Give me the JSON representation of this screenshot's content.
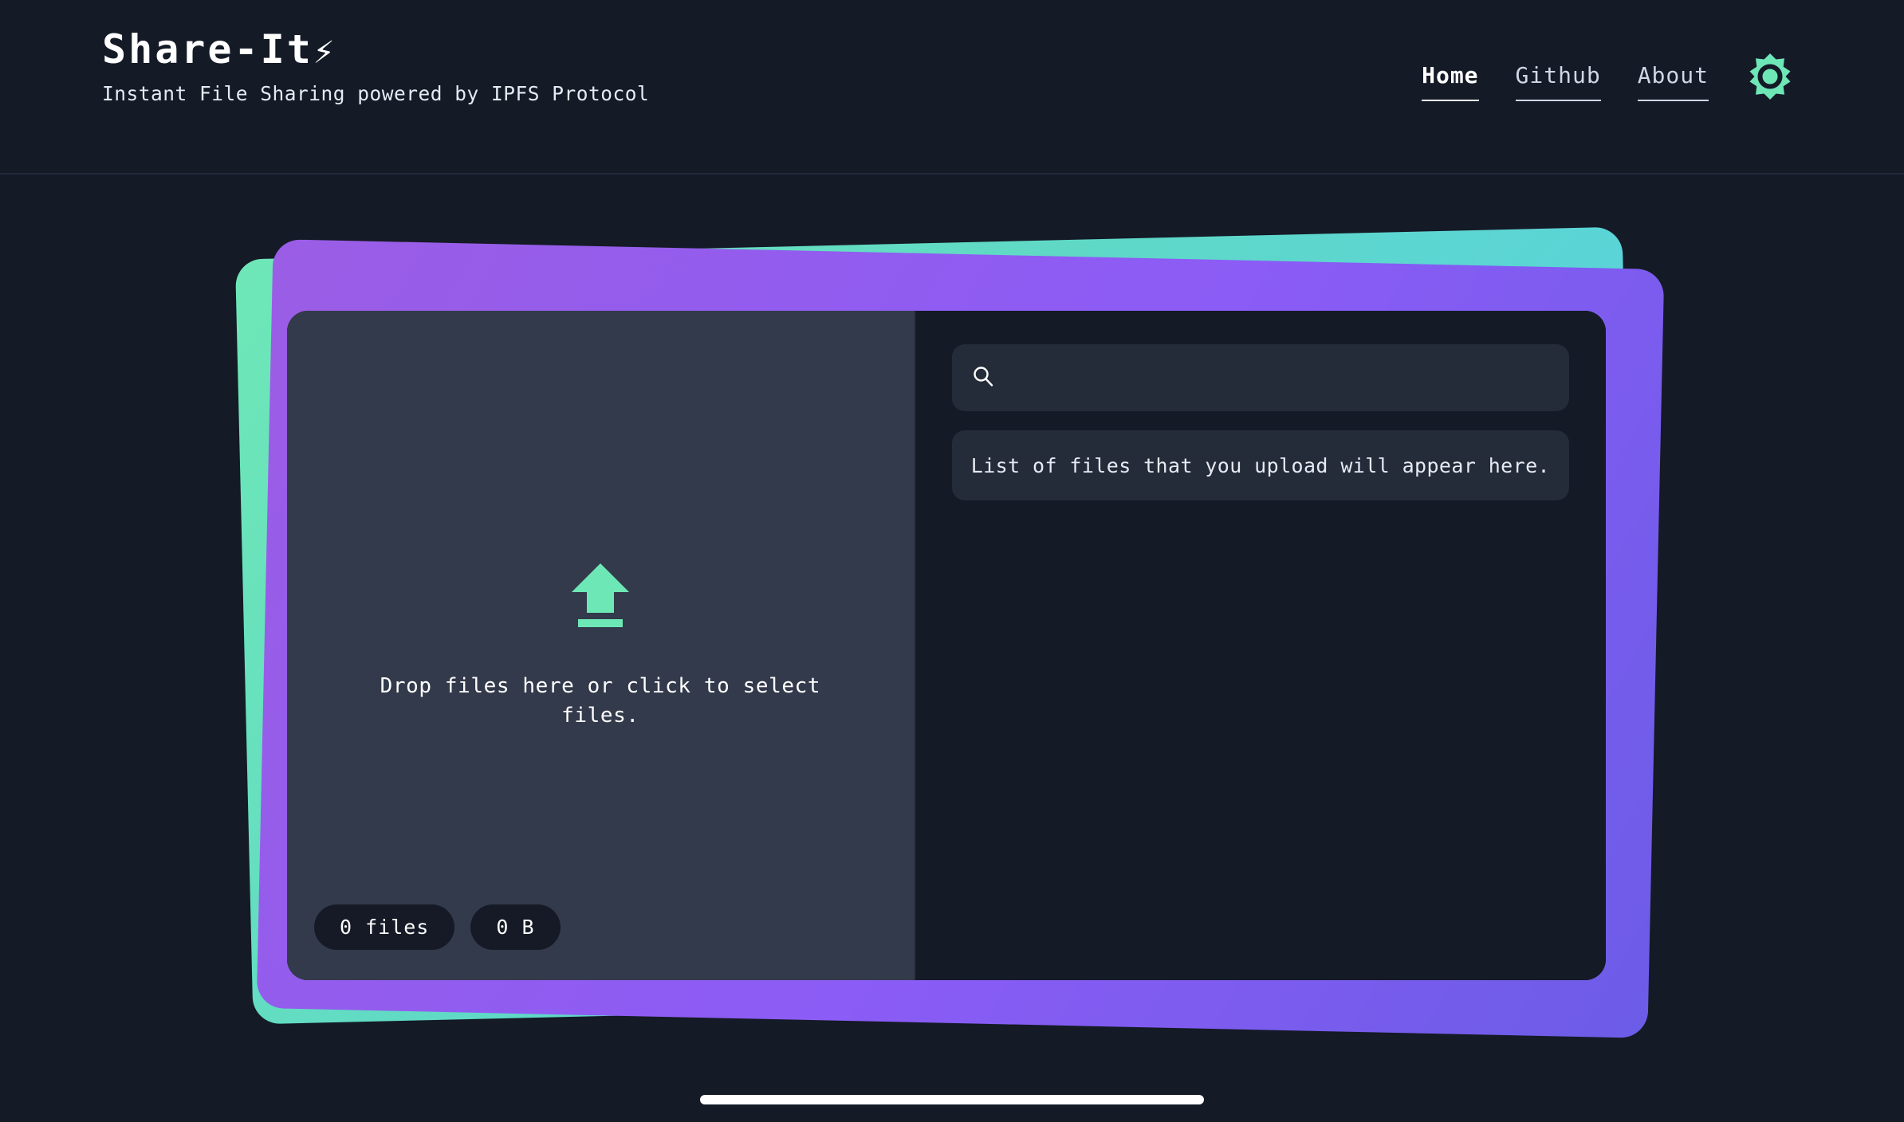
{
  "header": {
    "brand_title": "Share-It",
    "brand_bolt": "⚡",
    "brand_subtitle": "Instant File Sharing powered by IPFS Protocol",
    "nav": [
      {
        "label": "Home",
        "active": true
      },
      {
        "label": "Github",
        "active": false
      },
      {
        "label": "About",
        "active": false
      }
    ],
    "theme_toggle_icon": "sun-icon"
  },
  "dropzone": {
    "upload_icon": "upload-arrow-icon",
    "instruction": "Drop files here or click to select files.",
    "stats": [
      {
        "label": "0 files"
      },
      {
        "label": "0 B"
      }
    ]
  },
  "files_panel": {
    "search": {
      "icon": "search-icon",
      "value": "",
      "placeholder": ""
    },
    "empty_notice": "List of files that you upload will appear here."
  },
  "colors": {
    "background": "#141a26",
    "panel_left": "#333a4b",
    "panel_right": "#141a26",
    "field": "#242b39",
    "pill": "#151a26",
    "accent_green": "#6ee7b7",
    "accent_cyan": "#56cfe8",
    "accent_purple": "#9b5de5",
    "accent_indigo": "#6c5ce7",
    "text": "#ffffff",
    "bolt_yellow": "#f5a623"
  }
}
